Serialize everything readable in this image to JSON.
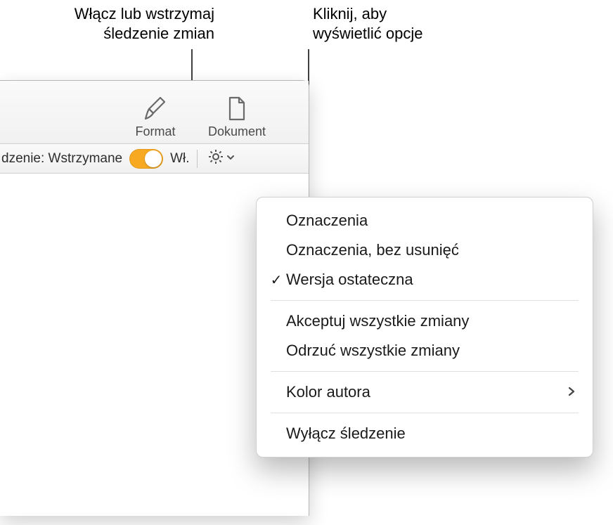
{
  "callouts": {
    "toggle": "Włącz lub wstrzymaj śledzenie zmian",
    "options": "Kliknij, aby wyświetlić opcje"
  },
  "toolbar": {
    "format": "Format",
    "document": "Dokument"
  },
  "trackbar": {
    "status": "dzenie: Wstrzymane",
    "on_label": "Wł."
  },
  "menu": {
    "markups": "Oznaczenia",
    "markups_no_deletions": "Oznaczenia, bez usunięć",
    "final": "Wersja ostateczna",
    "accept_all": "Akceptuj wszystkie zmiany",
    "reject_all": "Odrzuć wszystkie zmiany",
    "author_color": "Kolor autora",
    "turn_off": "Wyłącz śledzenie",
    "selected": "final"
  }
}
